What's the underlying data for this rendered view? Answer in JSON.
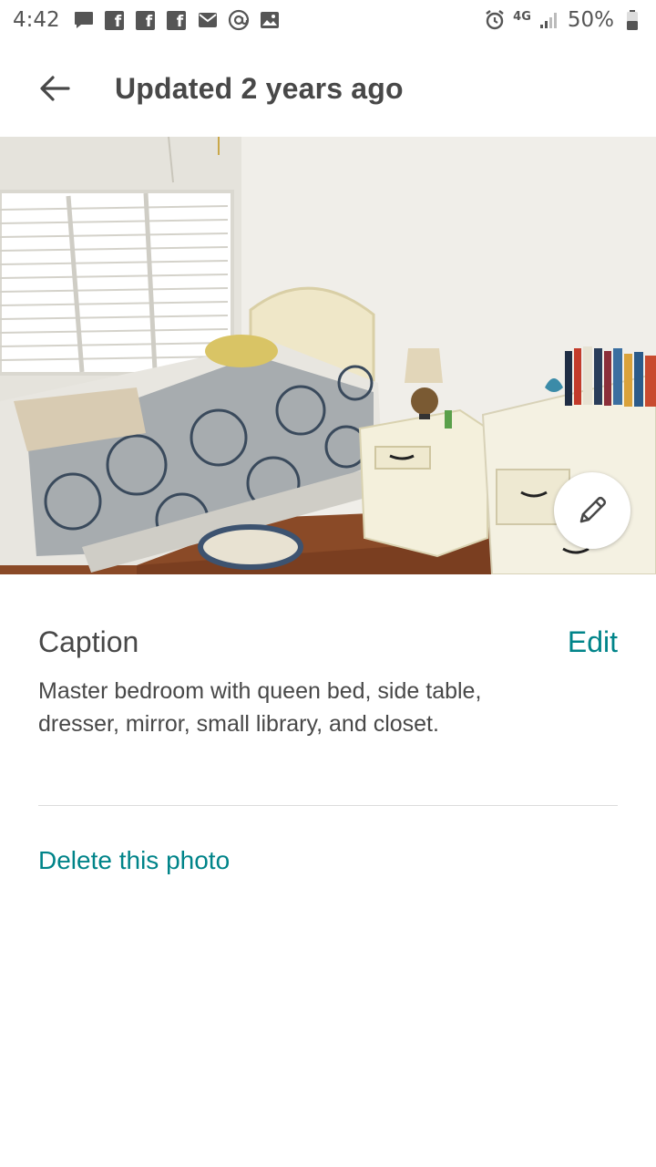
{
  "status_bar": {
    "time": "4:42",
    "network": "4G",
    "battery": "50%",
    "notification_icons": [
      "message-icon",
      "facebook-icon",
      "facebook-icon",
      "facebook-icon",
      "mail-icon",
      "at-icon",
      "image-icon"
    ]
  },
  "header": {
    "title": "Updated 2 years ago",
    "back_icon": "arrow-left-icon"
  },
  "photo": {
    "edit_icon": "pencil-icon"
  },
  "caption": {
    "label": "Caption",
    "edit_label": "Edit",
    "text": "Master bedroom with queen bed, side table, dresser, mirror, small library, and closet."
  },
  "actions": {
    "delete_label": "Delete this photo"
  },
  "colors": {
    "accent": "#008489",
    "text": "#484848"
  }
}
